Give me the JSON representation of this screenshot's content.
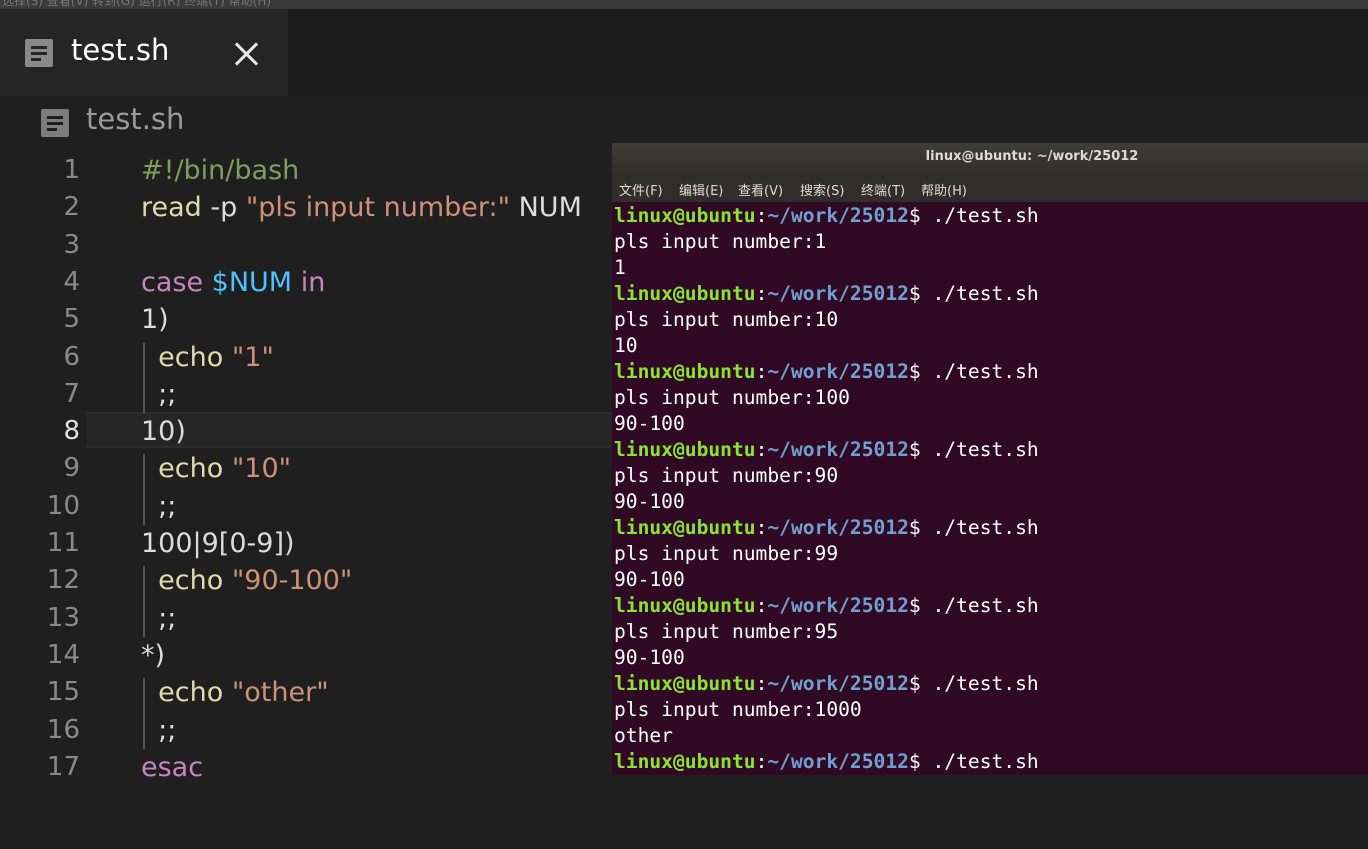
{
  "menubar_fragment": "选择(S)  查看(V)  转到(G)  运行(R)  终端(T)  帮助(H)",
  "tab": {
    "title": "test.sh"
  },
  "editor": {
    "title": "test.sh",
    "active_line": 8,
    "line_numbers": [
      "1",
      "2",
      "3",
      "4",
      "5",
      "6",
      "7",
      "8",
      "9",
      "10",
      "11",
      "12",
      "13",
      "14",
      "15",
      "16",
      "17"
    ],
    "lines": [
      [
        {
          "t": "#!/bin/bash",
          "c": "com"
        }
      ],
      [
        {
          "t": "read",
          "c": "cmd"
        },
        {
          "t": " -p ",
          "c": "txt"
        },
        {
          "t": "\"pls input number:\"",
          "c": "str"
        },
        {
          "t": " NUM",
          "c": "txt"
        }
      ],
      [],
      [
        {
          "t": "case",
          "c": "kw"
        },
        {
          "t": " ",
          "c": "txt"
        },
        {
          "t": "$NUM",
          "c": "var"
        },
        {
          "t": " ",
          "c": "txt"
        },
        {
          "t": "in",
          "c": "kw"
        }
      ],
      [
        {
          "t": "1)",
          "c": "txt"
        }
      ],
      [
        {
          "t": "  ",
          "c": "txt"
        },
        {
          "t": "echo",
          "c": "cmd"
        },
        {
          "t": " ",
          "c": "txt"
        },
        {
          "t": "\"1\"",
          "c": "str"
        }
      ],
      [
        {
          "t": "  ;;",
          "c": "txt"
        }
      ],
      [
        {
          "t": "10)",
          "c": "txt"
        }
      ],
      [
        {
          "t": "  ",
          "c": "txt"
        },
        {
          "t": "echo",
          "c": "cmd"
        },
        {
          "t": " ",
          "c": "txt"
        },
        {
          "t": "\"10\"",
          "c": "str"
        }
      ],
      [
        {
          "t": "  ;;",
          "c": "txt"
        }
      ],
      [
        {
          "t": "100|9[0-9])",
          "c": "txt"
        }
      ],
      [
        {
          "t": "  ",
          "c": "txt"
        },
        {
          "t": "echo",
          "c": "cmd"
        },
        {
          "t": " ",
          "c": "txt"
        },
        {
          "t": "\"90-100\"",
          "c": "str"
        }
      ],
      [
        {
          "t": "  ;;",
          "c": "txt"
        }
      ],
      [
        {
          "t": "*)",
          "c": "txt"
        }
      ],
      [
        {
          "t": "  ",
          "c": "txt"
        },
        {
          "t": "echo",
          "c": "cmd"
        },
        {
          "t": " ",
          "c": "txt"
        },
        {
          "t": "\"other\"",
          "c": "str"
        }
      ],
      [
        {
          "t": "  ;;",
          "c": "txt"
        }
      ],
      [
        {
          "t": "esac",
          "c": "kw"
        }
      ]
    ]
  },
  "terminal": {
    "title": "linux@ubuntu: ~/work/25012",
    "menu": [
      "文件(F)",
      "编辑(E)",
      "查看(V)",
      "搜索(S)",
      "终端(T)",
      "帮助(H)"
    ],
    "prompt_user": "linux@ubuntu",
    "prompt_sep": ":",
    "prompt_path": "~/work/25012",
    "prompt_end": "$ ",
    "lines": [
      {
        "type": "prompt",
        "cmd": "./test.sh"
      },
      {
        "type": "out",
        "text": "pls input number:1"
      },
      {
        "type": "out",
        "text": "1"
      },
      {
        "type": "prompt",
        "cmd": "./test.sh"
      },
      {
        "type": "out",
        "text": "pls input number:10"
      },
      {
        "type": "out",
        "text": "10"
      },
      {
        "type": "prompt",
        "cmd": "./test.sh"
      },
      {
        "type": "out",
        "text": "pls input number:100"
      },
      {
        "type": "out",
        "text": "90-100"
      },
      {
        "type": "prompt",
        "cmd": "./test.sh"
      },
      {
        "type": "out",
        "text": "pls input number:90"
      },
      {
        "type": "out",
        "text": "90-100"
      },
      {
        "type": "prompt",
        "cmd": "./test.sh"
      },
      {
        "type": "out",
        "text": "pls input number:99"
      },
      {
        "type": "out",
        "text": "90-100"
      },
      {
        "type": "prompt",
        "cmd": "./test.sh"
      },
      {
        "type": "out",
        "text": "pls input number:95"
      },
      {
        "type": "out",
        "text": "90-100"
      },
      {
        "type": "prompt",
        "cmd": "./test.sh"
      },
      {
        "type": "out",
        "text": "pls input number:1000"
      },
      {
        "type": "out",
        "text": "other"
      },
      {
        "type": "prompt",
        "cmd": "./test.sh"
      }
    ]
  },
  "colors": {
    "editor_bg": "#1f1f1f",
    "terminal_bg": "#300a24",
    "comment": "#7ba05b",
    "command": "#dcdcaa",
    "string": "#ce9178",
    "keyword": "#c586c0",
    "variable": "#4fc1ff",
    "prompt_user": "#8ae234",
    "prompt_path": "#729fcf"
  }
}
